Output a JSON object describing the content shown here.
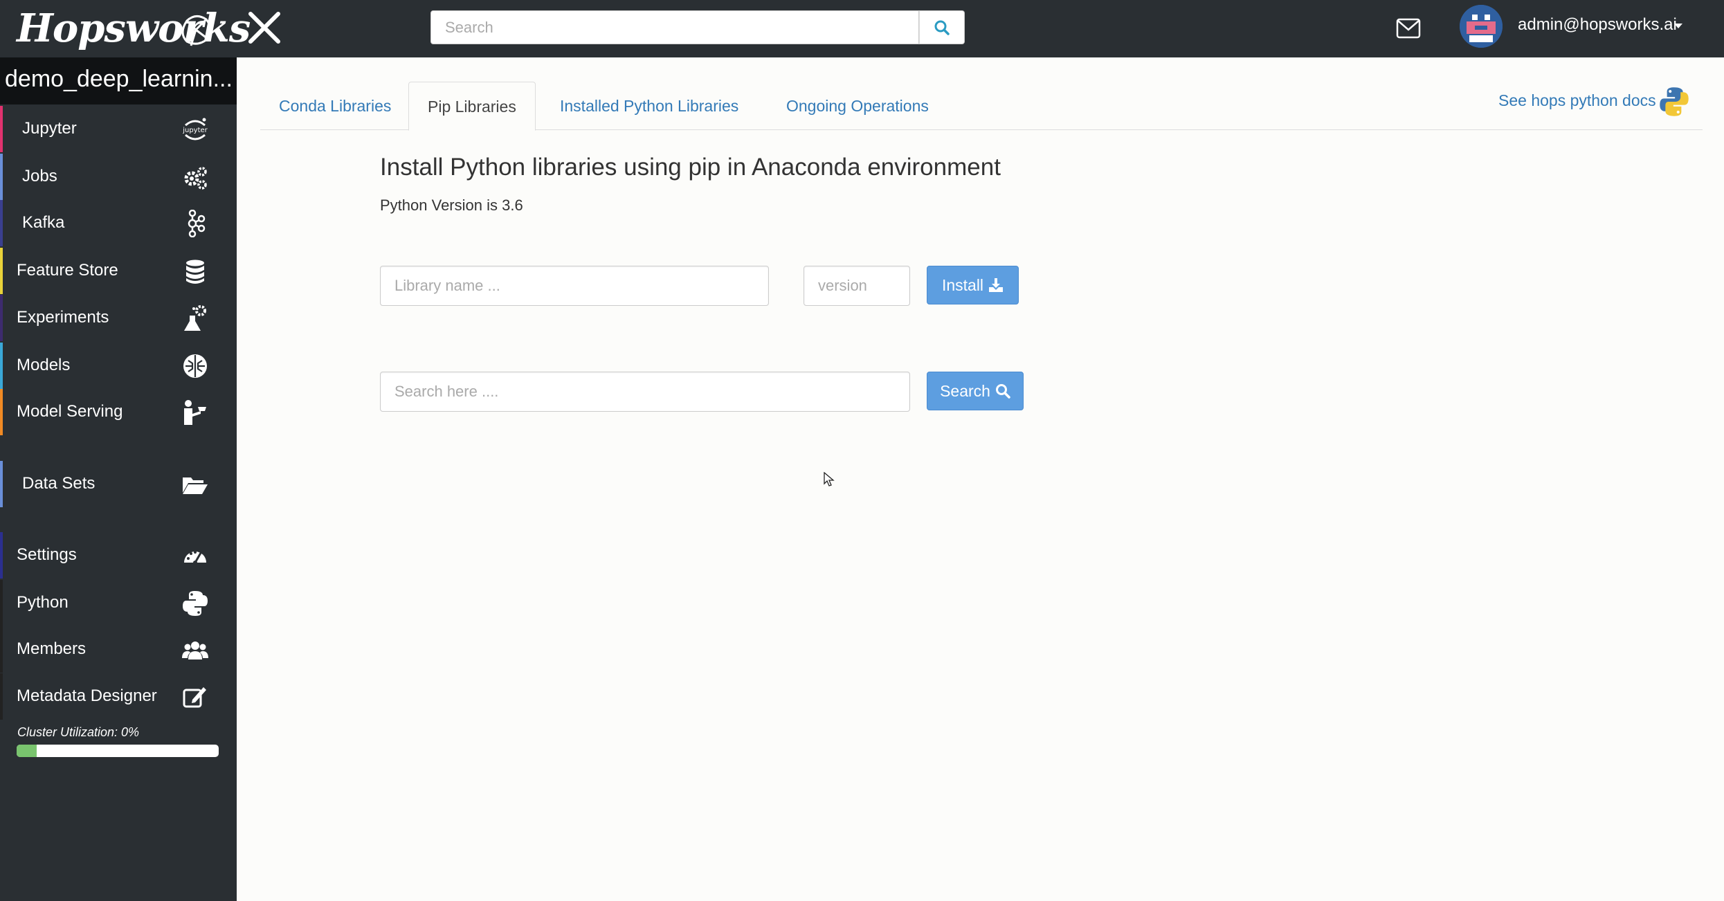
{
  "header": {
    "logo_text": "Hopsworks",
    "search_placeholder": "Search",
    "user_email": "admin@hopsworks.ai"
  },
  "sidebar": {
    "project_name": "demo_deep_learnin...",
    "items": [
      {
        "label": "Jupyter",
        "icon": "jupyter-icon",
        "color": "#e0326e"
      },
      {
        "label": "Jobs",
        "icon": "gears-icon",
        "color": "#6a8fd9"
      },
      {
        "label": "Kafka",
        "icon": "kafka-icon",
        "color": "#3a3f8f"
      },
      {
        "label": "Feature Store",
        "icon": "database-icon",
        "color": "#e8d23a"
      },
      {
        "label": "Experiments",
        "icon": "flask-icon",
        "color": "#3d2b6e"
      },
      {
        "label": "Models",
        "icon": "brain-icon",
        "color": "#3aa8d8"
      },
      {
        "label": "Model Serving",
        "icon": "serving-icon",
        "color": "#f08a24"
      },
      {
        "label": "Data Sets",
        "icon": "folder-open-icon",
        "color": "#6a8fd9"
      },
      {
        "label": "Settings",
        "icon": "dashboard-icon",
        "color": "#2b2f8f"
      },
      {
        "label": "Python",
        "icon": "python-icon",
        "color": "#222"
      },
      {
        "label": "Members",
        "icon": "users-icon",
        "color": "#222"
      },
      {
        "label": "Metadata Designer",
        "icon": "edit-icon",
        "color": "#222"
      }
    ],
    "cluster_label": "Cluster Utilization: 0%",
    "cluster_utilization": 0.1
  },
  "tabs": [
    {
      "label": "Conda Libraries",
      "active": false
    },
    {
      "label": "Pip Libraries",
      "active": true
    },
    {
      "label": "Installed Python Libraries",
      "active": false
    },
    {
      "label": "Ongoing Operations",
      "active": false
    }
  ],
  "docs_link": "See hops python docs",
  "main": {
    "heading": "Install Python libraries using pip in Anaconda environment",
    "python_version": "Python Version is 3.6",
    "library_placeholder": "Library name ...",
    "version_placeholder": "version",
    "install_label": "Install",
    "search_placeholder": "Search here ....",
    "search_label": "Search"
  },
  "colors": {
    "topbar": "#2a2f33",
    "button": "#5d9ee0",
    "link": "#337ab7"
  }
}
